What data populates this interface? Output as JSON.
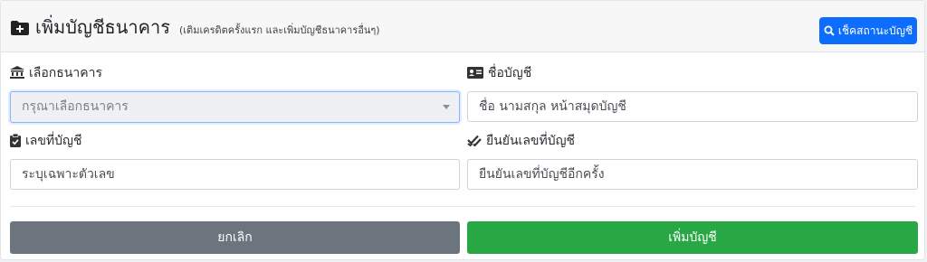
{
  "header": {
    "title": "เพิ่มบัญชีธนาคาร",
    "subtitle": "(เติมเครดิตครั้งแรก และเพิ่มบัญชีธนาคารอื่นๆ)",
    "check_status_label": "เช็คสถานะบัญชี"
  },
  "form": {
    "bank": {
      "label": "เลือกธนาคาร",
      "placeholder": "กรุณาเลือกธนาคาร"
    },
    "account_name": {
      "label": "ชื่อบัญชี",
      "placeholder": "ชื่อ นามสกุล หน้าสมุดบัญชี"
    },
    "account_number": {
      "label": "เลขที่บัญชี",
      "placeholder": "ระบุเฉพาะตัวเลข"
    },
    "confirm_account_number": {
      "label": "ยืนยันเลขที่บัญชี",
      "placeholder": "ยืนยันเลขที่บัญชีอีกครั้ง"
    }
  },
  "buttons": {
    "cancel_label": "ยกเลิก",
    "add_label": "เพิ่มบัญชี"
  },
  "colors": {
    "primary": "#0d6efd",
    "success": "#28a745",
    "secondary": "#6c757d"
  },
  "icons": {
    "header": "folder-plus-icon",
    "check_status": "search-icon",
    "bank": "bank-building-icon",
    "account_name": "id-card-icon",
    "account_number": "clipboard-check-icon",
    "confirm": "double-check-icon"
  }
}
